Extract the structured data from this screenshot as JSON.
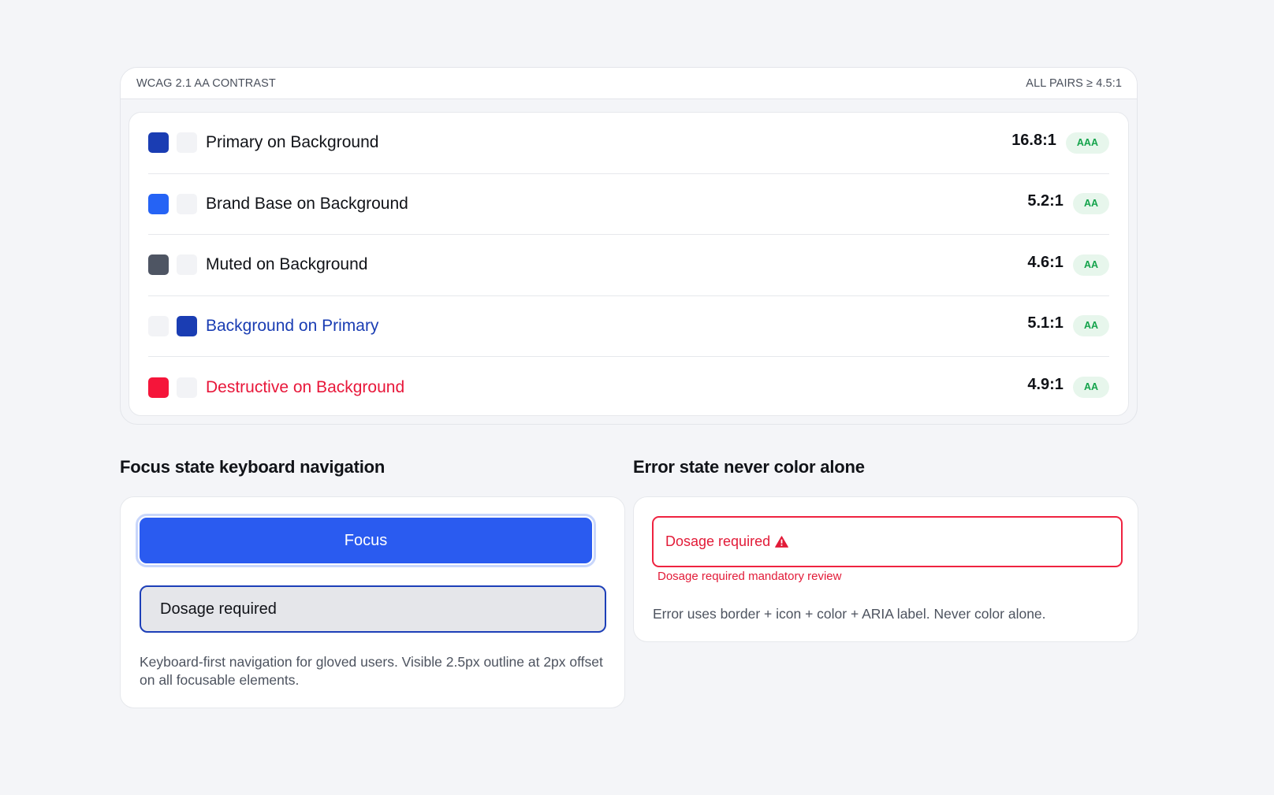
{
  "contrast": {
    "header_left": "WCAG 2.1 AA CONTRAST",
    "header_right": "ALL PAIRS ≥ 4.5:1",
    "rows": [
      {
        "label": "Primary on Background",
        "ratio": "16.8:1",
        "badge": "AAA",
        "fg": "#1a3db3",
        "bg": "#f2f3f6",
        "label_color": "#111318"
      },
      {
        "label": "Brand Base on Background",
        "ratio": "5.2:1",
        "badge": "AA",
        "fg": "#2563f5",
        "bg": "#f2f3f6",
        "label_color": "#111318"
      },
      {
        "label": "Muted on Background",
        "ratio": "4.6:1",
        "badge": "AA",
        "fg": "#4e5563",
        "bg": "#f2f3f6",
        "label_color": "#111318"
      },
      {
        "label": "Background on Primary",
        "ratio": "5.1:1",
        "badge": "AA",
        "fg": "#f2f3f6",
        "bg": "#1a3db3",
        "label_color": "#1a3db3"
      },
      {
        "label": "Destructive on Background",
        "ratio": "4.9:1",
        "badge": "AA",
        "fg": "#f5153a",
        "bg": "#f2f3f6",
        "label_color": "#e8173a"
      }
    ]
  },
  "focus": {
    "title": "Focus state keyboard navigation",
    "button_label": "Focus",
    "input_value": "Dosage required",
    "note": "Keyboard-first navigation for gloved users. Visible 2.5px outline at 2px offset on all focusable elements."
  },
  "error": {
    "title": "Error state never color alone",
    "input_value": "Dosage required",
    "message": "Dosage required mandatory review",
    "note": "Error uses border + icon + color + ARIA label. Never color alone.",
    "icon": "warning-triangle-icon"
  },
  "colors": {
    "page_bg": "#f4f5f8",
    "accent": "#2a5bf0",
    "focus_ring": "#1d3fb8",
    "error": "#ef2340",
    "badge_text": "#14a34b",
    "badge_bg": "#e7f6ec"
  }
}
